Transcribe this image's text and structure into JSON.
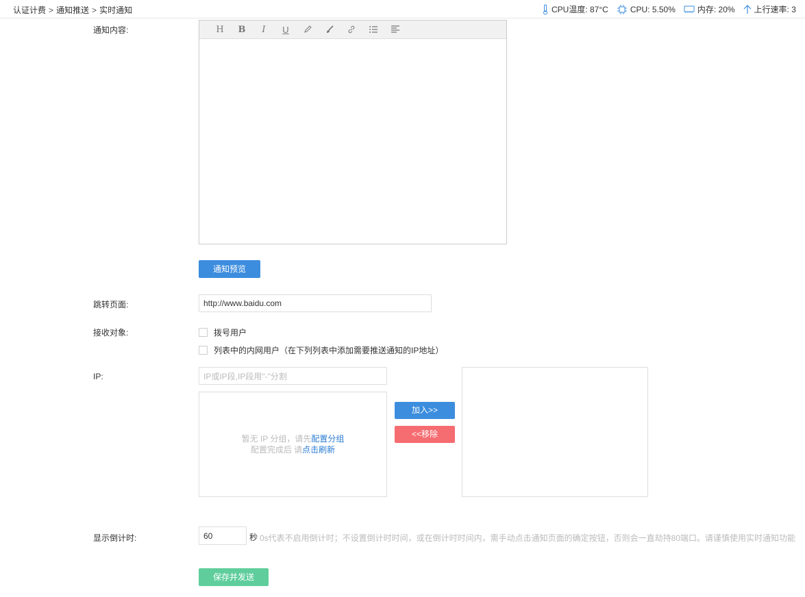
{
  "breadcrumb": {
    "items": [
      "认证计费",
      "通知推送",
      "实时通知"
    ],
    "separator": ">"
  },
  "status": {
    "cpu_temp": "CPU温度: 87°C",
    "cpu": "CPU: 5.50%",
    "memory": "内存: 20%",
    "upload": "上行速率: 3"
  },
  "form": {
    "content_label": "通知内容:",
    "editor_toolbar": [
      "H",
      "B",
      "I",
      "U"
    ],
    "preview_button": "通知预览",
    "redirect_label": "跳转页面:",
    "redirect_value": "http://www.baidu.com",
    "receiver_label": "接收对象:",
    "receiver_options": [
      "拨号用户",
      "列表中的内网用户（在下列列表中添加需要推送通知的IP地址）"
    ],
    "ip_label": "IP:",
    "ip_placeholder": "IP或IP段,IP段用\"-\"分割",
    "ip_empty_line1_prefix": "暂无 IP 分组，请先",
    "ip_empty_line1_link": "配置分组",
    "ip_empty_line2_prefix": "配置完成后 请",
    "ip_empty_line2_link": "点击刷新",
    "add_button": "加入>>",
    "remove_button": "<<移除",
    "countdown_label": "显示倒计时:",
    "countdown_value": "60",
    "countdown_unit": "秒",
    "countdown_hint": "0s代表不启用倒计时；不设置倒计时时间，或在倒计时时间内，需手动点击通知页面的确定按钮，否则会一直劫持80端口。请谨慎使用实时通知功能",
    "save_button": "保存并发送"
  },
  "colors": {
    "primary": "#3c8dde",
    "danger": "#f56c71",
    "success": "#5fce9c",
    "link": "#2b7cd3"
  }
}
